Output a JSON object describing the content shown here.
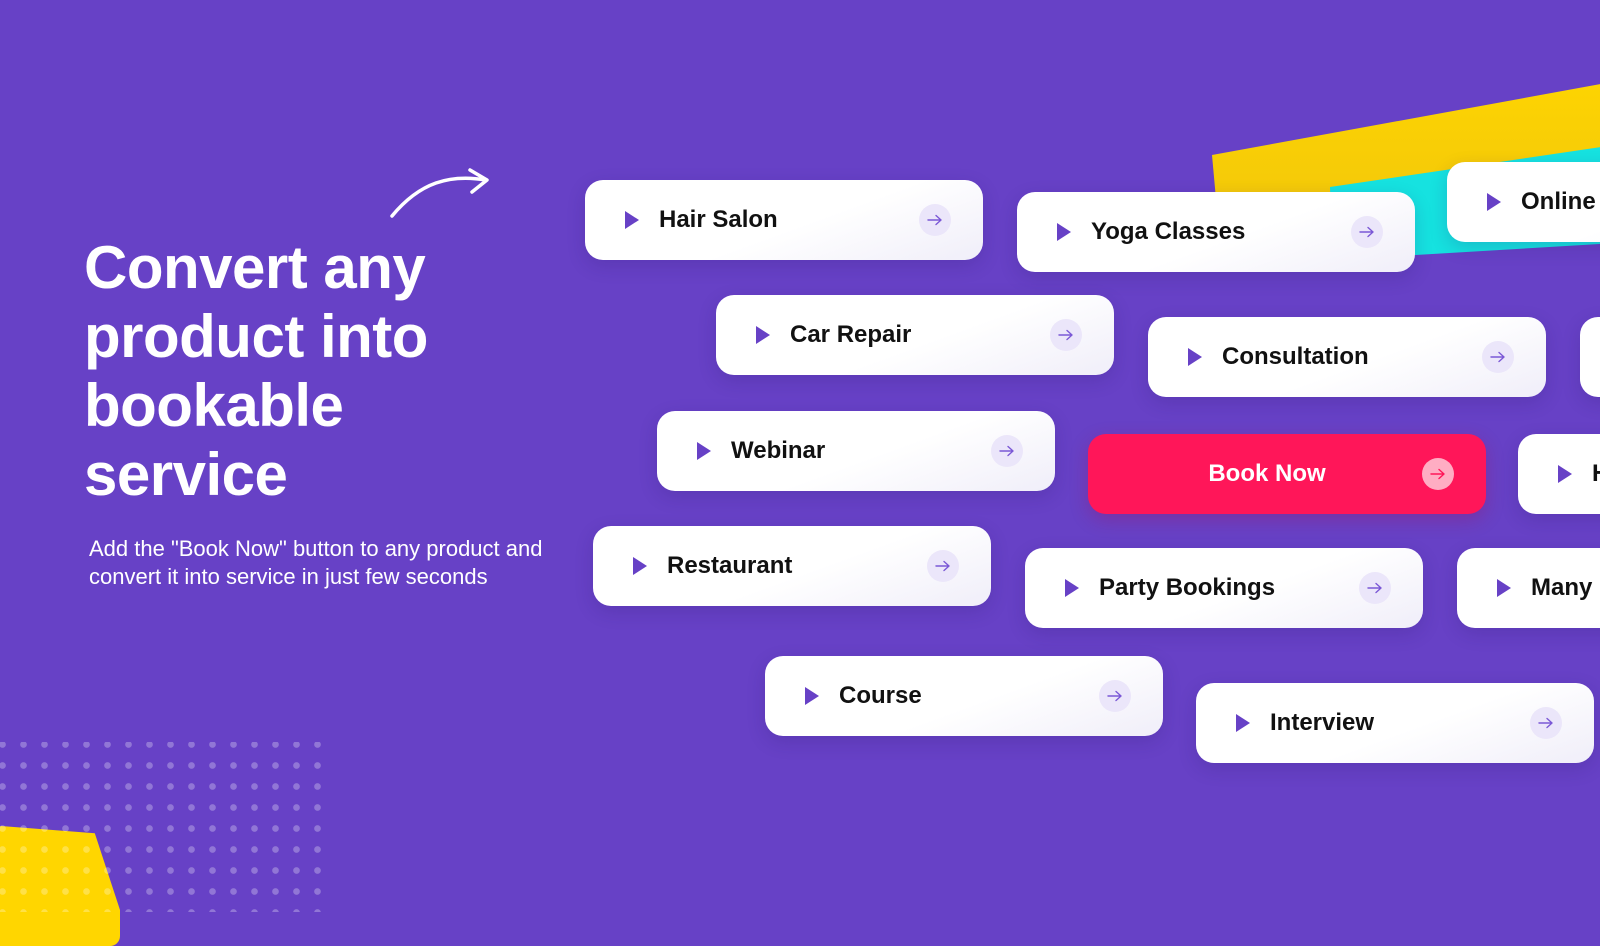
{
  "hero": {
    "headline": "Convert any product into bookable service",
    "subtext": "Add the \"Book Now\" button to any product and convert it into service in just few seconds"
  },
  "cards": [
    {
      "label": "Hair Salon",
      "icon": "play-icon",
      "action_icon": "arrow-right-icon"
    },
    {
      "label": "Yoga Classes",
      "icon": "play-icon",
      "action_icon": "arrow-right-icon"
    },
    {
      "label": "Online C",
      "icon": "play-icon",
      "action_icon": "arrow-right-icon"
    },
    {
      "label": "Car Repair",
      "icon": "play-icon",
      "action_icon": "arrow-right-icon"
    },
    {
      "label": "Consultation",
      "icon": "play-icon",
      "action_icon": "arrow-right-icon"
    },
    {
      "label": "",
      "icon": "",
      "action_icon": ""
    },
    {
      "label": "Webinar",
      "icon": "play-icon",
      "action_icon": "arrow-right-icon"
    },
    {
      "label": "Book Now",
      "icon": "",
      "action_icon": "arrow-right-icon",
      "primary": true
    },
    {
      "label": "H",
      "icon": "play-icon",
      "action_icon": "arrow-right-icon"
    },
    {
      "label": "Restaurant",
      "icon": "play-icon",
      "action_icon": "arrow-right-icon"
    },
    {
      "label": "Party Bookings",
      "icon": "play-icon",
      "action_icon": "arrow-right-icon"
    },
    {
      "label": "Many r",
      "icon": "play-icon",
      "action_icon": "arrow-right-icon"
    },
    {
      "label": "Course",
      "icon": "play-icon",
      "action_icon": "arrow-right-icon"
    },
    {
      "label": "Interview",
      "icon": "play-icon",
      "action_icon": "arrow-right-icon"
    }
  ],
  "colors": {
    "background": "#6741c6",
    "primary_button": "#ff1659",
    "accent_yellow": "#ffd600",
    "accent_cyan": "#16e2e0",
    "play_icon": "#6741c6",
    "arrow_circle": "#ebe6fa"
  }
}
